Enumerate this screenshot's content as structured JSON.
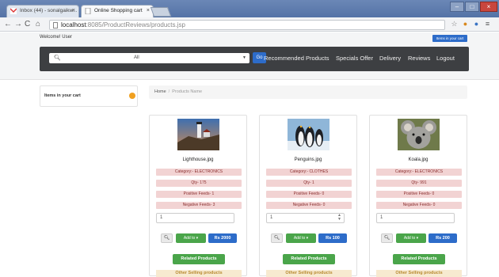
{
  "browser": {
    "tabs": [
      {
        "label": "Inbox (44) - sonalgaikw..."
      },
      {
        "label": "Online Shopping cart"
      }
    ],
    "url_host": "localhost",
    "url_path": ":8085/ProductReviews/products.jsp"
  },
  "header": {
    "welcome": "Welcome! User",
    "cart_button": "Items in your cart"
  },
  "navbar": {
    "search_placeholder": "",
    "category_selected": "All",
    "go_label": "Go",
    "links": [
      "Recommended Products",
      "Specials Offer",
      "Delivery",
      "Reviews",
      "Logout"
    ]
  },
  "sidebar": {
    "cart_label": "Items in your cart"
  },
  "breadcrumb": {
    "home": "Home",
    "current": "Products Name"
  },
  "products": [
    {
      "name": "Lighthouse.jpg",
      "category": "Category:- ELECTRONICS",
      "qty": "Qty- 175",
      "positive": "Positive Feeds- 1",
      "negative": "Negative Feeds- 3",
      "quantity_value": "1",
      "add_label": "Add to",
      "price": "Rs 2000",
      "related": "Related Products",
      "other": "Other Selling products"
    },
    {
      "name": "Penguins.jpg",
      "category": "Category:- CLOTHES",
      "qty": "Qty- 1",
      "positive": "Positive Feeds- 0",
      "negative": "Negative Feeds- 0",
      "quantity_value": "1",
      "add_label": "Add to",
      "price": "Rs 100",
      "related": "Related Products",
      "other": "Other Selling products"
    },
    {
      "name": "Koala.jpg",
      "category": "Category:- ELECTRONICS",
      "qty": "Qty- 991",
      "positive": "Positive Feeds- 0",
      "negative": "Negative Feeds- 0",
      "quantity_value": "1",
      "add_label": "Add to",
      "price": "Rs 200",
      "related": "Related Products",
      "other": "Other Selling products"
    }
  ],
  "colors": {
    "primary": "#2d6cc9",
    "success": "#4aa54a",
    "navbar": "#3d3f42",
    "pill": "#f2d3d3",
    "badge": "#f0a020"
  }
}
